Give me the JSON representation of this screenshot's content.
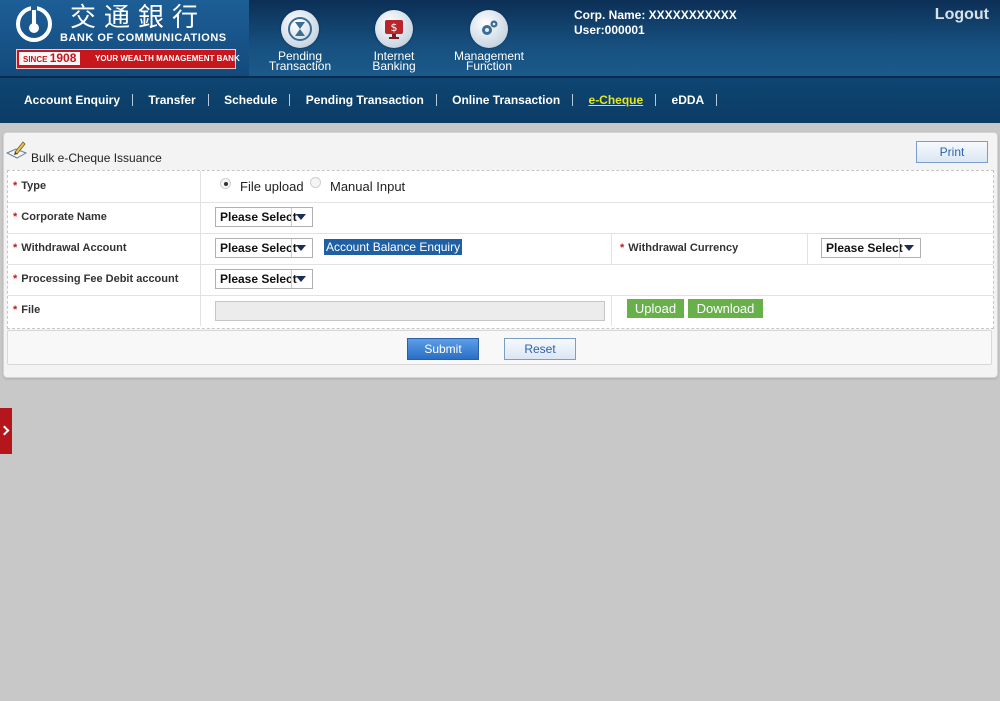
{
  "header": {
    "bank_name_cn": "交通銀行",
    "bank_name_en": "BANK OF COMMUNICATIONS",
    "since_label": "SINCE",
    "since_year": "1908",
    "slogan": "YOUR WEALTH MANAGEMENT BANK",
    "corp_name": "Corp. Name: XXXXXXXXXXX",
    "user": "User:000001",
    "logout": "Logout",
    "icons": [
      {
        "line1": "Pending",
        "line2": "Transaction",
        "icon": "hourglass-icon"
      },
      {
        "line1": "Internet",
        "line2": "Banking",
        "icon": "dollar-monitor-icon"
      },
      {
        "line1": "Management",
        "line2": "Function",
        "icon": "gears-icon"
      }
    ]
  },
  "nav": {
    "items": [
      "Account Enquiry",
      "Transfer",
      "Schedule",
      "Pending Transaction",
      "Online Transaction",
      "e-Cheque",
      "eDDA"
    ],
    "active": "e-Cheque"
  },
  "panel": {
    "title": "Bulk e-Cheque Issuance",
    "print": "Print"
  },
  "form": {
    "required_mark": "*",
    "type_label": "Type",
    "type_options": [
      "File upload",
      "Manual Input"
    ],
    "type_selected": "File upload",
    "corporate_label": "Corporate Name",
    "withdrawal_label": "Withdrawal Account",
    "balance_link": "Account Balance Enquiry",
    "currency_label": "Withdrawal Currency",
    "fee_label": "Processing Fee Debit account",
    "file_label": "File",
    "select_placeholder": "Please Select",
    "upload": "Upload",
    "download": "Download",
    "submit": "Submit",
    "reset": "Reset"
  },
  "colors": {
    "header_bg": "#17507f",
    "nav_bg": "#0e4572",
    "active_nav": "#e6e61b",
    "brand_red": "#c8161d",
    "green_button": "#68b14a",
    "blue_button": "#2a6fc6"
  }
}
